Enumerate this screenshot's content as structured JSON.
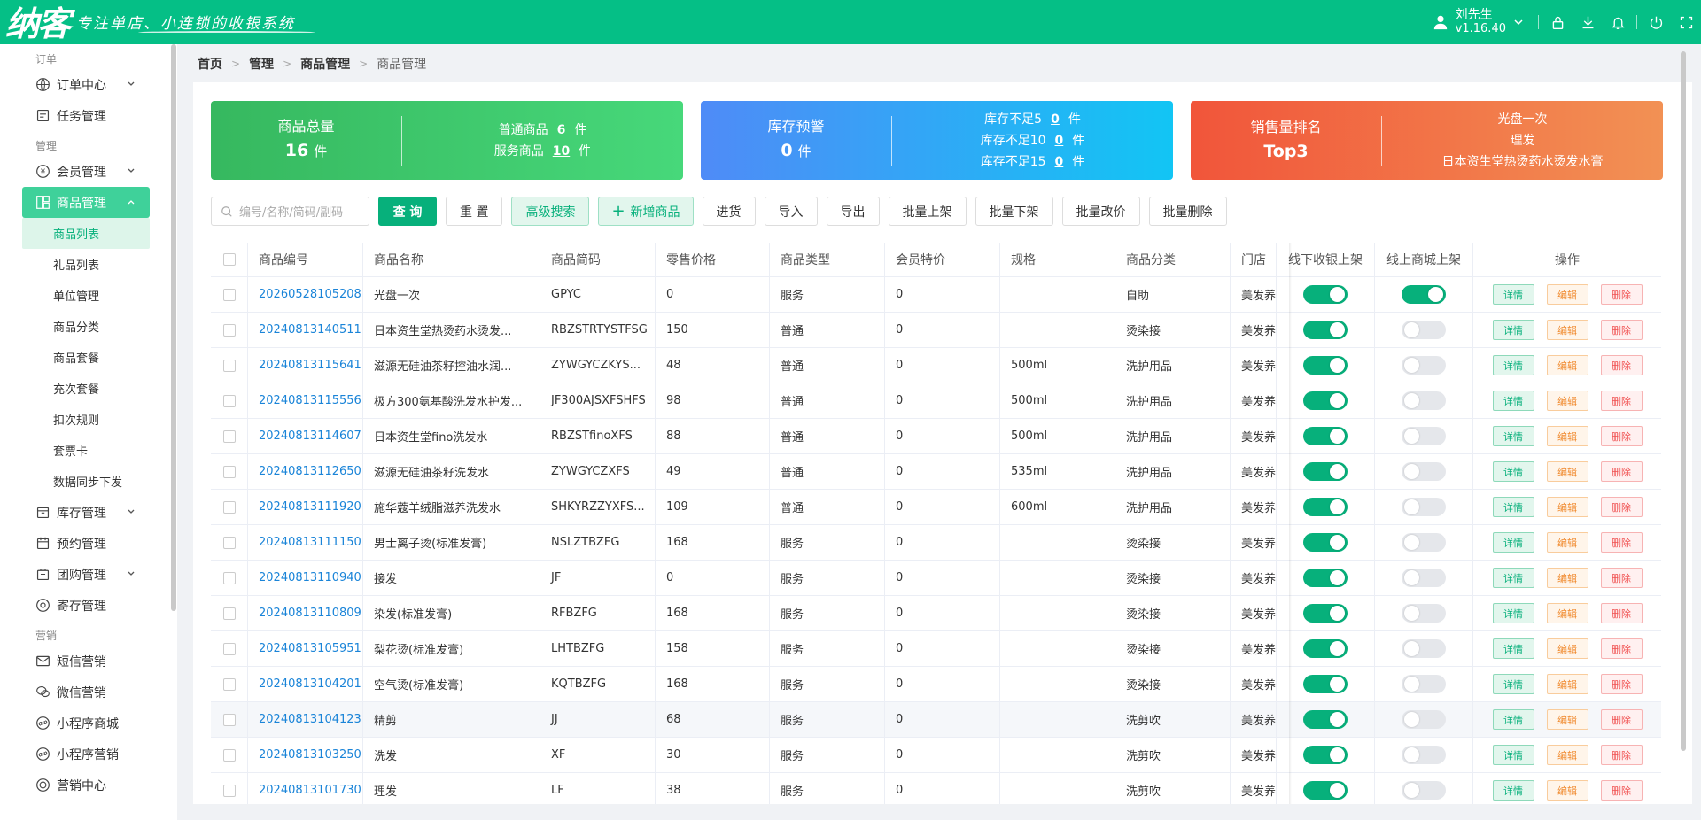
{
  "header": {
    "brand": "纳客",
    "slogan": "专注单店、小连锁的收银系统",
    "user_name": "刘先生",
    "version": "v1.16.40",
    "icons": [
      "lock-icon",
      "download-icon",
      "bell-icon",
      "power-icon",
      "fullscreen-icon"
    ]
  },
  "sidebar": {
    "groups": [
      {
        "label": "订单"
      },
      {
        "label": "管理"
      },
      {
        "label": "营销"
      }
    ],
    "items": {
      "orders": "订单中心",
      "tasks": "任务管理",
      "members": "会员管理",
      "products": "商品管理",
      "inventory": "库存管理",
      "booking": "预约管理",
      "groupbuy": "团购管理",
      "deposit": "寄存管理",
      "sms": "短信营销",
      "wechat": "微信营销",
      "mini_mall": "小程序商城",
      "mini_marketing": "小程序营销",
      "marketing_center": "营销中心"
    },
    "product_sub": [
      "商品列表",
      "礼品列表",
      "单位管理",
      "商品分类",
      "商品套餐",
      "充次套餐",
      "扣次规则",
      "套票卡",
      "数据同步下发"
    ]
  },
  "breadcrumb": [
    "首页",
    "管理",
    "商品管理",
    "商品管理"
  ],
  "cards": {
    "total": {
      "title": "商品总量",
      "value": "16",
      "unit": "件",
      "normal_label": "普通商品",
      "normal_value": "6",
      "service_label": "服务商品",
      "service_value": "10",
      "item_unit": "件"
    },
    "stock": {
      "title": "库存预警",
      "value": "0",
      "unit": "件",
      "r1_label": "库存不足5",
      "r1_value": "0",
      "r2_label": "库存不足10",
      "r2_value": "0",
      "r3_label": "库存不足15",
      "r3_value": "0",
      "item_unit": "件"
    },
    "sales": {
      "title": "销售量排名",
      "value": "Top3",
      "r1": "光盘一次",
      "r2": "理发",
      "r3": "日本资生堂热烫药水烫发水膏"
    }
  },
  "toolbar": {
    "search_placeholder": "编号/名称/简码/副码",
    "query": "查 询",
    "reset": "重 置",
    "advanced": "高级搜索",
    "add": "新增商品",
    "stock_in": "进货",
    "import": "导入",
    "export": "导出",
    "batch_on": "批量上架",
    "batch_off": "批量下架",
    "batch_price": "批量改价",
    "batch_delete": "批量删除"
  },
  "table": {
    "headers": [
      "商品编号",
      "商品名称",
      "商品简码",
      "零售价格",
      "商品类型",
      "会员特价",
      "规格",
      "商品分类",
      "门店",
      "线下收银上架",
      "线上商城上架",
      "操作"
    ],
    "actions": {
      "detail": "详情",
      "edit": "编辑",
      "delete": "删除"
    },
    "rows": [
      {
        "code": "20260528105208",
        "name": "光盘一次",
        "short": "GPYC",
        "price": "0",
        "type": "服务",
        "member": "0",
        "spec": "",
        "category": "自助",
        "store": "美发养",
        "offline": true,
        "online": true
      },
      {
        "code": "20240813140511",
        "name": "日本资生堂热烫药水烫发...",
        "short": "RBZSTRTYSTFSG",
        "price": "150",
        "type": "普通",
        "member": "0",
        "spec": "",
        "category": "烫染接",
        "store": "美发养",
        "offline": true,
        "online": false
      },
      {
        "code": "20240813115641",
        "name": "滋源无硅油茶籽控油水润...",
        "short": "ZYWGYCZKYS...",
        "price": "48",
        "type": "普通",
        "member": "0",
        "spec": "500ml",
        "category": "洗护用品",
        "store": "美发养",
        "offline": true,
        "online": false
      },
      {
        "code": "20240813115556",
        "name": "极方300氨基酸洗发水护发...",
        "short": "JF300AJSXFSHFS",
        "price": "98",
        "type": "普通",
        "member": "0",
        "spec": "500ml",
        "category": "洗护用品",
        "store": "美发养",
        "offline": true,
        "online": false
      },
      {
        "code": "20240813114607",
        "name": "日本资生堂fino洗发水",
        "short": "RBZSTfinoXFS",
        "price": "88",
        "type": "普通",
        "member": "0",
        "spec": "500ml",
        "category": "洗护用品",
        "store": "美发养",
        "offline": true,
        "online": false
      },
      {
        "code": "20240813112650",
        "name": "滋源无硅油茶籽洗发水",
        "short": "ZYWGYCZXFS",
        "price": "49",
        "type": "普通",
        "member": "0",
        "spec": "535ml",
        "category": "洗护用品",
        "store": "美发养",
        "offline": true,
        "online": false
      },
      {
        "code": "20240813111920",
        "name": "施华蔻羊绒脂滋养洗发水",
        "short": "SHKYRZZYXFS...",
        "price": "109",
        "type": "普通",
        "member": "0",
        "spec": "600ml",
        "category": "洗护用品",
        "store": "美发养",
        "offline": true,
        "online": false
      },
      {
        "code": "20240813111150",
        "name": "男士离子烫(标准发膏)",
        "short": "NSLZTBZFG",
        "price": "168",
        "type": "服务",
        "member": "0",
        "spec": "",
        "category": "烫染接",
        "store": "美发养",
        "offline": true,
        "online": false
      },
      {
        "code": "20240813110940",
        "name": "接发",
        "short": "JF",
        "price": "0",
        "type": "服务",
        "member": "0",
        "spec": "",
        "category": "烫染接",
        "store": "美发养",
        "offline": true,
        "online": false
      },
      {
        "code": "20240813110809",
        "name": "染发(标准发膏)",
        "short": "RFBZFG",
        "price": "168",
        "type": "服务",
        "member": "0",
        "spec": "",
        "category": "烫染接",
        "store": "美发养",
        "offline": true,
        "online": false
      },
      {
        "code": "20240813105951",
        "name": "梨花烫(标准发膏)",
        "short": "LHTBZFG",
        "price": "158",
        "type": "服务",
        "member": "0",
        "spec": "",
        "category": "烫染接",
        "store": "美发养",
        "offline": true,
        "online": false
      },
      {
        "code": "20240813104201",
        "name": "空气烫(标准发膏)",
        "short": "KQTBZFG",
        "price": "168",
        "type": "服务",
        "member": "0",
        "spec": "",
        "category": "烫染接",
        "store": "美发养",
        "offline": true,
        "online": false
      },
      {
        "code": "20240813104123",
        "name": "精剪",
        "short": "JJ",
        "price": "68",
        "type": "服务",
        "member": "0",
        "spec": "",
        "category": "洗剪吹",
        "store": "美发养",
        "offline": true,
        "online": false
      },
      {
        "code": "20240813103250",
        "name": "洗发",
        "short": "XF",
        "price": "30",
        "type": "服务",
        "member": "0",
        "spec": "",
        "category": "洗剪吹",
        "store": "美发养",
        "offline": true,
        "online": false
      },
      {
        "code": "20240813101730",
        "name": "理发",
        "short": "LF",
        "price": "38",
        "type": "服务",
        "member": "0",
        "spec": "",
        "category": "洗剪吹",
        "store": "美发养",
        "offline": true,
        "online": false
      }
    ]
  },
  "colors": {
    "brand": "#05bf86",
    "primary": "#07b07b",
    "link": "#1a84d8"
  }
}
